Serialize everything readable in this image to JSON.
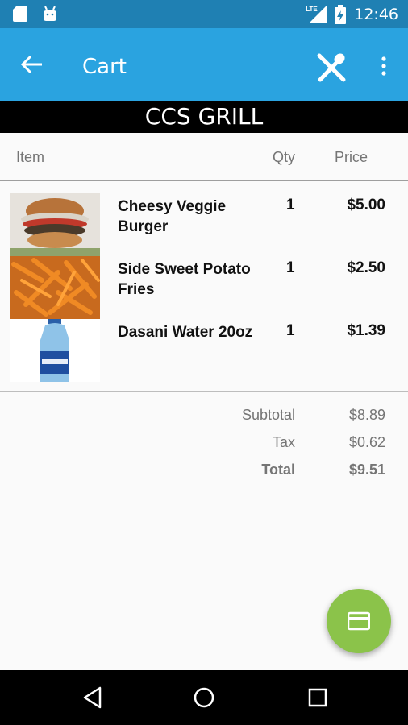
{
  "status_bar": {
    "time": "12:46",
    "network": "LTE",
    "icons": [
      "sd-card-icon",
      "android-icon",
      "lte-signal-icon",
      "battery-charging-icon"
    ]
  },
  "app_bar": {
    "title": "Cart",
    "icons": [
      "back-arrow-icon",
      "utensils-icon",
      "overflow-menu-icon"
    ]
  },
  "store": {
    "name": "CCS GRILL"
  },
  "columns": {
    "item": "Item",
    "qty": "Qty",
    "price": "Price"
  },
  "items": [
    {
      "name": "Cheesy Veggie Burger",
      "qty": "1",
      "price": "$5.00",
      "image": "burger"
    },
    {
      "name": "Side Sweet Potato Fries",
      "qty": "1",
      "price": "$2.50",
      "image": "fries"
    },
    {
      "name": "Dasani Water 20oz",
      "qty": "1",
      "price": "$1.39",
      "image": "water-bottle"
    }
  ],
  "totals": {
    "subtotal_label": "Subtotal",
    "subtotal": "$8.89",
    "tax_label": "Tax",
    "tax": "$0.62",
    "total_label": "Total",
    "total": "$9.51"
  },
  "fab": {
    "icon": "credit-card-icon"
  },
  "nav_bar": {
    "icons": [
      "back-triangle-icon",
      "home-circle-icon",
      "recents-square-icon"
    ]
  },
  "colors": {
    "status_bar": "#1f80b3",
    "app_bar": "#2aa3e0",
    "fab": "#8bc34a",
    "banner": "#000000"
  }
}
